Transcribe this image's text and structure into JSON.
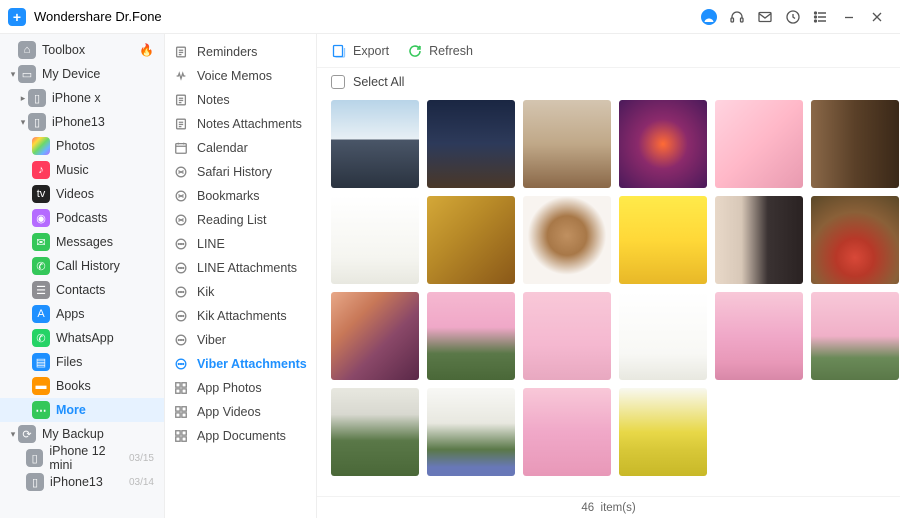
{
  "title": "Wondershare Dr.Fone",
  "header_icons": [
    "account-icon",
    "headset-icon",
    "mail-icon",
    "history-icon",
    "list-icon",
    "minimize-icon",
    "close-icon"
  ],
  "sidebar": {
    "toolbox": {
      "label": "Toolbox"
    },
    "mydevice": {
      "label": "My Device"
    },
    "iphonex": {
      "label": "iPhone x"
    },
    "iphone13": {
      "label": "iPhone13"
    },
    "photos": {
      "label": "Photos"
    },
    "music": {
      "label": "Music"
    },
    "videos": {
      "label": "Videos"
    },
    "podcasts": {
      "label": "Podcasts"
    },
    "messages": {
      "label": "Messages"
    },
    "call": {
      "label": "Call History"
    },
    "contacts": {
      "label": "Contacts"
    },
    "apps": {
      "label": "Apps"
    },
    "whatsapp": {
      "label": "WhatsApp"
    },
    "files": {
      "label": "Files"
    },
    "books": {
      "label": "Books"
    },
    "more": {
      "label": "More"
    },
    "mybackup": {
      "label": "My Backup"
    },
    "bk1": {
      "label": "iPhone 12 mini",
      "date": "03/15"
    },
    "bk2": {
      "label": "iPhone13",
      "date": "03/14"
    }
  },
  "middle": [
    {
      "key": "reminders",
      "label": "Reminders"
    },
    {
      "key": "voicememos",
      "label": "Voice Memos"
    },
    {
      "key": "notes",
      "label": "Notes"
    },
    {
      "key": "notesatt",
      "label": "Notes Attachments"
    },
    {
      "key": "calendar",
      "label": "Calendar"
    },
    {
      "key": "safari",
      "label": "Safari History"
    },
    {
      "key": "bookmarks",
      "label": "Bookmarks"
    },
    {
      "key": "reading",
      "label": "Reading List"
    },
    {
      "key": "line",
      "label": "LINE"
    },
    {
      "key": "lineatt",
      "label": "LINE Attachments"
    },
    {
      "key": "kik",
      "label": "Kik"
    },
    {
      "key": "kikatt",
      "label": "Kik Attachments"
    },
    {
      "key": "viber",
      "label": "Viber"
    },
    {
      "key": "viberatt",
      "label": "Viber Attachments"
    },
    {
      "key": "appphotos",
      "label": "App Photos"
    },
    {
      "key": "appvideos",
      "label": "App Videos"
    },
    {
      "key": "appdocs",
      "label": "App Documents"
    }
  ],
  "middle_active": "viberatt",
  "toolbar": {
    "export": "Export",
    "refresh": "Refresh"
  },
  "selectall": "Select All",
  "thumbs": [
    {
      "css": "background:linear-gradient(180deg,#b8d4e8 0%,#e8f0f5 45%,#4a5668 45%,#2a3340 100%);"
    },
    {
      "css": "background:linear-gradient(180deg,#1a2642 0%,#2d3a5a 50%,#4a3828 100%);"
    },
    {
      "css": "background:linear-gradient(180deg,#d4c5b0 0%,#c0a888 50%,#8a6848 100%);"
    },
    {
      "css": "background:radial-gradient(circle at 50% 50%,#ff6b35 0%,#8b2a6b 40%,#4a1a5a 100%);"
    },
    {
      "css": "background:linear-gradient(135deg,#ffd4e0 0%,#ffb8c8 50%,#e89ab0 100%);"
    },
    {
      "css": "background:linear-gradient(90deg,#8a6848 0%,#5a4028 50%,#3a2818 100%);"
    },
    {
      "css": "background:linear-gradient(180deg,#ffffff 0%,#f5f5f0 70%,#e8e8e0 100%);"
    },
    {
      "css": "background:linear-gradient(135deg,#d4a838 0%,#b88a28 40%,#8a5818 100%);"
    },
    {
      "css": "background:radial-gradient(circle at 50% 45%,#c09060 0%,#a87848 30%,#f8f4f0 60%);"
    },
    {
      "css": "background:linear-gradient(180deg,#ffea4a 0%,#ffd838 50%,#e8b828 100%);"
    },
    {
      "css": "background:linear-gradient(90deg,#e8d8c8 0%,#d8c8b8 30%,#3a3232 60%,#2a2222 100%);"
    },
    {
      "css": "background:radial-gradient(circle at 50% 70%,#d84838 0%,#b83828 25%,#8a6038 60%,#5a4828 100%);"
    },
    {
      "css": "background:linear-gradient(135deg,#e8a888 0%,#c87858 30%,#8a4868 60%,#5a2848 100%);"
    },
    {
      "css": "background:linear-gradient(180deg,#f5b8d0 0%,#f0a8c8 40%,#5a7848 70%,#4a6838 100%);"
    },
    {
      "css": "background:linear-gradient(180deg,#f8c8d8 0%,#f5b8d0 60%,#e8a8c0 100%);"
    },
    {
      "css": "background:linear-gradient(180deg,#ffffff 0%,#f8f8f5 70%,#e8e8e0 100%);"
    },
    {
      "css": "background:linear-gradient(180deg,#f8c8d8 0%,#f0a8c8 50%,#e898b8 80%,#d888a8 100%);"
    },
    {
      "css": "background:linear-gradient(180deg,#f8c8d8 0%,#f0b0c8 50%,#6a8a58 75%,#5a7848 100%);"
    },
    {
      "css": "background:linear-gradient(180deg,#e8e8e0 0%,#d8d8d0 30%,#5a7848 60%,#4a6838 100%);"
    },
    {
      "css": "background:linear-gradient(180deg,#f8f8f5 0%,#e8e8e0 40%,#5a7848 70%,#6878b8 90%);"
    },
    {
      "css": "background:linear-gradient(180deg,#f8c8d8 0%,#f0a8c8 50%,#e898b8 100%);"
    },
    {
      "css": "background:linear-gradient(180deg,#f8f8f0 0%,#e8d848 50%,#d8c838 70%,#c8b828 100%);"
    }
  ],
  "footer": {
    "count": "46",
    "suffix": "item(s)"
  }
}
